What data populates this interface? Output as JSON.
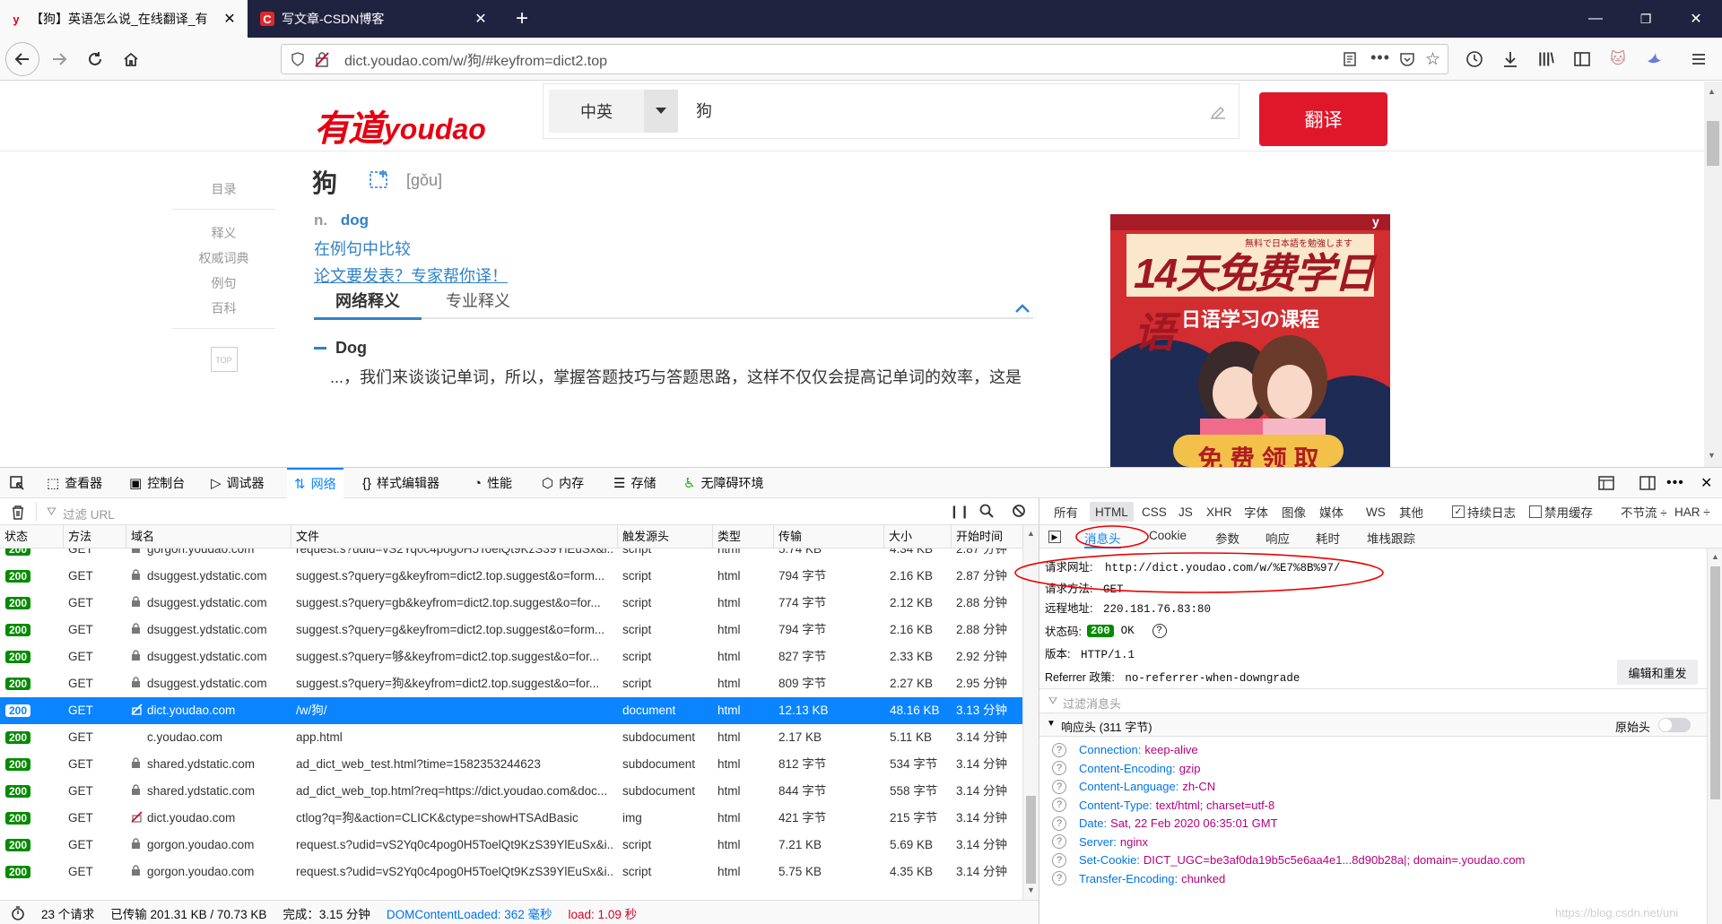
{
  "browser": {
    "tabs": [
      {
        "title": "【狗】英语怎么说_在线翻译_有",
        "favicon": "y",
        "active": true
      },
      {
        "title": "写文章-CSDN博客",
        "favicon": "C",
        "active": false
      }
    ],
    "url": "dict.youdao.com/w/狗/#keyfrom=dict2.top",
    "colors": {
      "titlebar": "#202340",
      "accent": "#0a84ff"
    }
  },
  "youdao": {
    "logo_cn": "有道",
    "logo_en": "youdao",
    "lang_select": "中英",
    "search_value": "狗",
    "translate_button": "翻译",
    "sidebar": [
      "目录",
      "释义",
      "权威词典",
      "例句",
      "百科"
    ],
    "top_button": "TOP",
    "word": "狗",
    "phonetic": "[gǒu]",
    "pos": "n.",
    "meaning": "dog",
    "link_compare": "在例句中比较",
    "link_paper": "论文要发表？专家帮你译！",
    "tabs": [
      "网络释义",
      "专业释义"
    ],
    "entry_title": "Dog",
    "entry_text": "...，我们来谈谈记单词，所以，掌握答题技巧与答题思路，这样不仅仅会提高记单词的效率，这是",
    "ad": {
      "title": "14天免费学日语",
      "small": "無料で日本語を勉強します",
      "subtitle": "日语学习の课程",
      "cta": "免 费 领 取",
      "corner": "y"
    }
  },
  "devtools": {
    "tools": [
      "查看器",
      "控制台",
      "调试器",
      "网络",
      "样式编辑器",
      "性能",
      "内存",
      "存储",
      "无障碍环境"
    ],
    "filter_placeholder": "过滤 URL",
    "type_filters": [
      "所有",
      "HTML",
      "CSS",
      "JS",
      "XHR",
      "字体",
      "图像",
      "媒体",
      "WS",
      "其他"
    ],
    "persist_log": "持续日志",
    "disable_cache": "禁用缓存",
    "throttle": "不节流 ÷",
    "har": "HAR ÷",
    "columns": [
      "状态",
      "方法",
      "域名",
      "文件",
      "触发源头",
      "类型",
      "传输",
      "大小",
      "开始时间"
    ],
    "requests": [
      {
        "status": "200",
        "method": "GET",
        "domain": "gorgon.youdao.com",
        "file": "request.s?udid=vS2Yq0c4pog0H5ToelQt9KzS39YlEuSx&i...",
        "cause": "script",
        "type": "html",
        "transferred": "5.74 KB",
        "size": "4.34 KB",
        "start": "2.87 分钟",
        "secure": true
      },
      {
        "status": "200",
        "method": "GET",
        "domain": "dsuggest.ydstatic.com",
        "file": "suggest.s?query=g&keyfrom=dict2.top.suggest&o=form...",
        "cause": "script",
        "type": "html",
        "transferred": "794 字节",
        "size": "2.16 KB",
        "start": "2.87 分钟",
        "secure": true
      },
      {
        "status": "200",
        "method": "GET",
        "domain": "dsuggest.ydstatic.com",
        "file": "suggest.s?query=gb&keyfrom=dict2.top.suggest&o=for...",
        "cause": "script",
        "type": "html",
        "transferred": "774 字节",
        "size": "2.12 KB",
        "start": "2.88 分钟",
        "secure": true
      },
      {
        "status": "200",
        "method": "GET",
        "domain": "dsuggest.ydstatic.com",
        "file": "suggest.s?query=g&keyfrom=dict2.top.suggest&o=form...",
        "cause": "script",
        "type": "html",
        "transferred": "794 字节",
        "size": "2.16 KB",
        "start": "2.88 分钟",
        "secure": true
      },
      {
        "status": "200",
        "method": "GET",
        "domain": "dsuggest.ydstatic.com",
        "file": "suggest.s?query=够&keyfrom=dict2.top.suggest&o=for...",
        "cause": "script",
        "type": "html",
        "transferred": "827 字节",
        "size": "2.33 KB",
        "start": "2.92 分钟",
        "secure": true
      },
      {
        "status": "200",
        "method": "GET",
        "domain": "dsuggest.ydstatic.com",
        "file": "suggest.s?query=狗&keyfrom=dict2.top.suggest&o=for...",
        "cause": "script",
        "type": "html",
        "transferred": "809 字节",
        "size": "2.27 KB",
        "start": "2.95 分钟",
        "secure": true
      },
      {
        "status": "200",
        "method": "GET",
        "domain": "dict.youdao.com",
        "file": "/w/狗/",
        "cause": "document",
        "type": "html",
        "transferred": "12.13 KB",
        "size": "48.16 KB",
        "start": "3.13 分钟",
        "secure": false,
        "selected": true
      },
      {
        "status": "200",
        "method": "GET",
        "domain": "c.youdao.com",
        "file": "app.html",
        "cause": "subdocument",
        "type": "html",
        "transferred": "2.17 KB",
        "size": "5.11 KB",
        "start": "3.14 分钟",
        "secure": null
      },
      {
        "status": "200",
        "method": "GET",
        "domain": "shared.ydstatic.com",
        "file": "ad_dict_web_test.html?time=1582353244623",
        "cause": "subdocument",
        "type": "html",
        "transferred": "812 字节",
        "size": "534 字节",
        "start": "3.14 分钟",
        "secure": true
      },
      {
        "status": "200",
        "method": "GET",
        "domain": "shared.ydstatic.com",
        "file": "ad_dict_web_top.html?req=https://dict.youdao.com&doc...",
        "cause": "subdocument",
        "type": "html",
        "transferred": "844 字节",
        "size": "558 字节",
        "start": "3.14 分钟",
        "secure": true
      },
      {
        "status": "200",
        "method": "GET",
        "domain": "dict.youdao.com",
        "file": "ctlog?q=狗&action=CLICK&ctype=showHTSAdBasic",
        "cause": "img",
        "type": "html",
        "transferred": "421 字节",
        "size": "215 字节",
        "start": "3.14 分钟",
        "secure": false
      },
      {
        "status": "200",
        "method": "GET",
        "domain": "gorgon.youdao.com",
        "file": "request.s?udid=vS2Yq0c4pog0H5ToelQt9KzS39YlEuSx&i...",
        "cause": "script",
        "type": "html",
        "transferred": "7.21 KB",
        "size": "5.69 KB",
        "start": "3.14 分钟",
        "secure": true
      },
      {
        "status": "200",
        "method": "GET",
        "domain": "gorgon.youdao.com",
        "file": "request.s?udid=vS2Yq0c4pog0H5ToelQt9KzS39YlEuSx&i...",
        "cause": "script",
        "type": "html",
        "transferred": "5.75 KB",
        "size": "4.35 KB",
        "start": "3.14 分钟",
        "secure": true
      }
    ],
    "status": {
      "requests": "23 个请求",
      "transferred": "已传输 201.31 KB / 70.73 KB",
      "finish": "完成：3.15 分钟",
      "dcl": "DOMContentLoaded: 362 毫秒",
      "load": "load: 1.09 秒"
    },
    "detail": {
      "tabs": [
        "消息头",
        "Cookie",
        "参数",
        "响应",
        "耗时",
        "堆栈跟踪"
      ],
      "request_url_label": "请求网址:",
      "request_url": "http://dict.youdao.com/w/%E7%8B%97/",
      "method_label": "请求方法:",
      "method": "GET",
      "remote_label": "远程地址:",
      "remote": "220.181.76.83:80",
      "status_label": "状态码:",
      "status_code": "200",
      "status_text": "OK",
      "version_label": "版本:",
      "version": "HTTP/1.1",
      "referrer_label": "Referrer 政策:",
      "referrer": "no-referrer-when-downgrade",
      "edit_resend": "编辑和重发",
      "filter_headers": "过滤消息头",
      "response_headers": "响应头 (311 字节)",
      "raw_headers": "原始头",
      "headers": [
        {
          "k": "Connection:",
          "v": "keep-alive"
        },
        {
          "k": "Content-Encoding:",
          "v": "gzip"
        },
        {
          "k": "Content-Language:",
          "v": "zh-CN"
        },
        {
          "k": "Content-Type:",
          "v": "text/html; charset=utf-8"
        },
        {
          "k": "Date:",
          "v": "Sat, 22 Feb 2020 06:35:01 GMT"
        },
        {
          "k": "Server:",
          "v": "nginx"
        },
        {
          "k": "Set-Cookie:",
          "v": "DICT_UGC=be3af0da19b5c5e6aa4e1...8d90b28a|; domain=.youdao.com"
        },
        {
          "k": "Transfer-Encoding:",
          "v": "chunked"
        }
      ]
    },
    "watermark": "https://blog.csdn.net/uni"
  }
}
